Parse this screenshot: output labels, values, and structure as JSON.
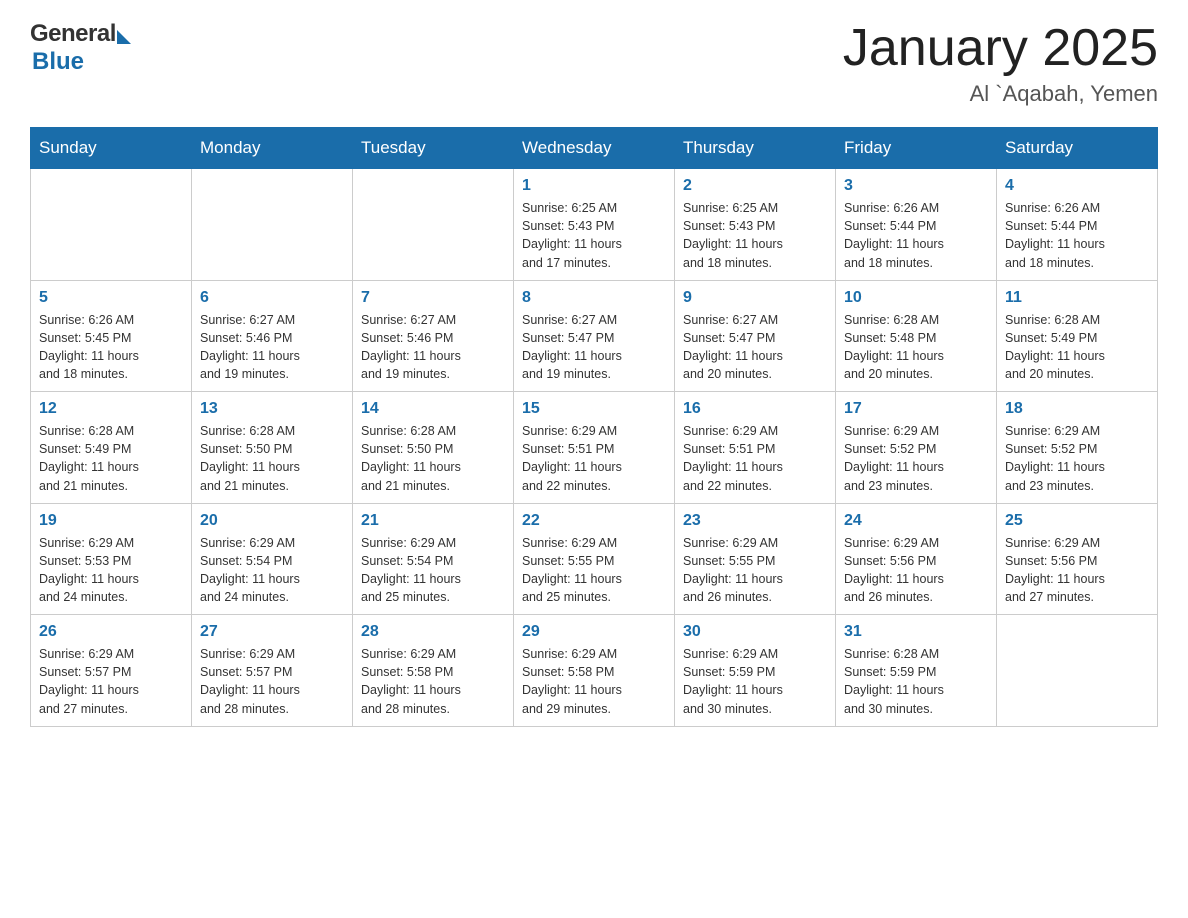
{
  "header": {
    "logo_general": "General",
    "logo_blue": "Blue",
    "month_title": "January 2025",
    "location": "Al `Aqabah, Yemen"
  },
  "weekdays": [
    "Sunday",
    "Monday",
    "Tuesday",
    "Wednesday",
    "Thursday",
    "Friday",
    "Saturday"
  ],
  "weeks": [
    [
      {
        "day": "",
        "info": ""
      },
      {
        "day": "",
        "info": ""
      },
      {
        "day": "",
        "info": ""
      },
      {
        "day": "1",
        "info": "Sunrise: 6:25 AM\nSunset: 5:43 PM\nDaylight: 11 hours\nand 17 minutes."
      },
      {
        "day": "2",
        "info": "Sunrise: 6:25 AM\nSunset: 5:43 PM\nDaylight: 11 hours\nand 18 minutes."
      },
      {
        "day": "3",
        "info": "Sunrise: 6:26 AM\nSunset: 5:44 PM\nDaylight: 11 hours\nand 18 minutes."
      },
      {
        "day": "4",
        "info": "Sunrise: 6:26 AM\nSunset: 5:44 PM\nDaylight: 11 hours\nand 18 minutes."
      }
    ],
    [
      {
        "day": "5",
        "info": "Sunrise: 6:26 AM\nSunset: 5:45 PM\nDaylight: 11 hours\nand 18 minutes."
      },
      {
        "day": "6",
        "info": "Sunrise: 6:27 AM\nSunset: 5:46 PM\nDaylight: 11 hours\nand 19 minutes."
      },
      {
        "day": "7",
        "info": "Sunrise: 6:27 AM\nSunset: 5:46 PM\nDaylight: 11 hours\nand 19 minutes."
      },
      {
        "day": "8",
        "info": "Sunrise: 6:27 AM\nSunset: 5:47 PM\nDaylight: 11 hours\nand 19 minutes."
      },
      {
        "day": "9",
        "info": "Sunrise: 6:27 AM\nSunset: 5:47 PM\nDaylight: 11 hours\nand 20 minutes."
      },
      {
        "day": "10",
        "info": "Sunrise: 6:28 AM\nSunset: 5:48 PM\nDaylight: 11 hours\nand 20 minutes."
      },
      {
        "day": "11",
        "info": "Sunrise: 6:28 AM\nSunset: 5:49 PM\nDaylight: 11 hours\nand 20 minutes."
      }
    ],
    [
      {
        "day": "12",
        "info": "Sunrise: 6:28 AM\nSunset: 5:49 PM\nDaylight: 11 hours\nand 21 minutes."
      },
      {
        "day": "13",
        "info": "Sunrise: 6:28 AM\nSunset: 5:50 PM\nDaylight: 11 hours\nand 21 minutes."
      },
      {
        "day": "14",
        "info": "Sunrise: 6:28 AM\nSunset: 5:50 PM\nDaylight: 11 hours\nand 21 minutes."
      },
      {
        "day": "15",
        "info": "Sunrise: 6:29 AM\nSunset: 5:51 PM\nDaylight: 11 hours\nand 22 minutes."
      },
      {
        "day": "16",
        "info": "Sunrise: 6:29 AM\nSunset: 5:51 PM\nDaylight: 11 hours\nand 22 minutes."
      },
      {
        "day": "17",
        "info": "Sunrise: 6:29 AM\nSunset: 5:52 PM\nDaylight: 11 hours\nand 23 minutes."
      },
      {
        "day": "18",
        "info": "Sunrise: 6:29 AM\nSunset: 5:52 PM\nDaylight: 11 hours\nand 23 minutes."
      }
    ],
    [
      {
        "day": "19",
        "info": "Sunrise: 6:29 AM\nSunset: 5:53 PM\nDaylight: 11 hours\nand 24 minutes."
      },
      {
        "day": "20",
        "info": "Sunrise: 6:29 AM\nSunset: 5:54 PM\nDaylight: 11 hours\nand 24 minutes."
      },
      {
        "day": "21",
        "info": "Sunrise: 6:29 AM\nSunset: 5:54 PM\nDaylight: 11 hours\nand 25 minutes."
      },
      {
        "day": "22",
        "info": "Sunrise: 6:29 AM\nSunset: 5:55 PM\nDaylight: 11 hours\nand 25 minutes."
      },
      {
        "day": "23",
        "info": "Sunrise: 6:29 AM\nSunset: 5:55 PM\nDaylight: 11 hours\nand 26 minutes."
      },
      {
        "day": "24",
        "info": "Sunrise: 6:29 AM\nSunset: 5:56 PM\nDaylight: 11 hours\nand 26 minutes."
      },
      {
        "day": "25",
        "info": "Sunrise: 6:29 AM\nSunset: 5:56 PM\nDaylight: 11 hours\nand 27 minutes."
      }
    ],
    [
      {
        "day": "26",
        "info": "Sunrise: 6:29 AM\nSunset: 5:57 PM\nDaylight: 11 hours\nand 27 minutes."
      },
      {
        "day": "27",
        "info": "Sunrise: 6:29 AM\nSunset: 5:57 PM\nDaylight: 11 hours\nand 28 minutes."
      },
      {
        "day": "28",
        "info": "Sunrise: 6:29 AM\nSunset: 5:58 PM\nDaylight: 11 hours\nand 28 minutes."
      },
      {
        "day": "29",
        "info": "Sunrise: 6:29 AM\nSunset: 5:58 PM\nDaylight: 11 hours\nand 29 minutes."
      },
      {
        "day": "30",
        "info": "Sunrise: 6:29 AM\nSunset: 5:59 PM\nDaylight: 11 hours\nand 30 minutes."
      },
      {
        "day": "31",
        "info": "Sunrise: 6:28 AM\nSunset: 5:59 PM\nDaylight: 11 hours\nand 30 minutes."
      },
      {
        "day": "",
        "info": ""
      }
    ]
  ]
}
